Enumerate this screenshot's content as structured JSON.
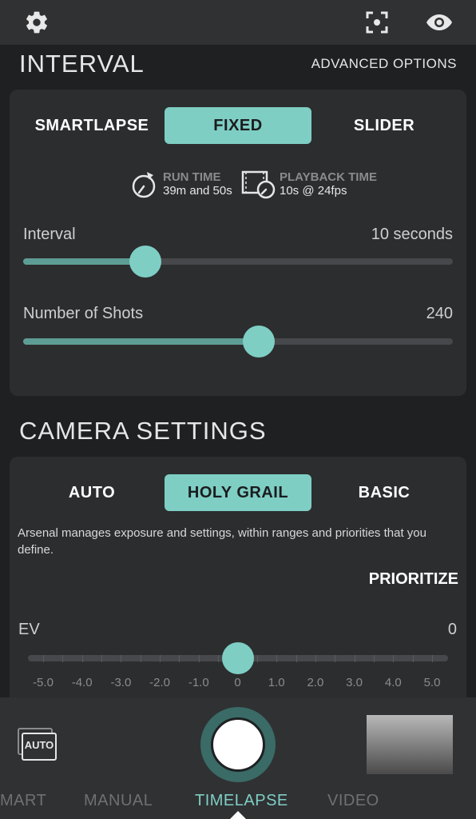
{
  "interval_section": {
    "title": "INTERVAL",
    "advanced_options": "ADVANCED OPTIONS",
    "tabs": [
      {
        "label": "SMARTLAPSE",
        "active": false
      },
      {
        "label": "FIXED",
        "active": true
      },
      {
        "label": "SLIDER",
        "active": false
      }
    ],
    "run_time": {
      "label": "RUN TIME",
      "value": "39m and 50s"
    },
    "playback_time": {
      "label": "PLAYBACK TIME",
      "value": "10s @ 24fps"
    },
    "interval": {
      "label": "Interval",
      "value": "10 seconds",
      "fraction": 0.285
    },
    "shots": {
      "label": "Number of Shots",
      "value": "240",
      "fraction": 0.548
    }
  },
  "camera_section": {
    "title": "CAMERA SETTINGS",
    "tabs": [
      {
        "label": "AUTO",
        "active": false
      },
      {
        "label": "HOLY GRAIL",
        "active": true
      },
      {
        "label": "BASIC",
        "active": false
      }
    ],
    "description": "Arsenal manages exposure and settings, within ranges and priorities that you define.",
    "prioritize": "PRIORITIZE",
    "ev": {
      "label": "EV",
      "value": "0",
      "min": -5.0,
      "max": 5.0,
      "current": 0.0
    },
    "ev_ticks": [
      "-5.0",
      "-4.0",
      "-3.0",
      "-2.0",
      "-1.0",
      "0",
      "1.0",
      "2.0",
      "3.0",
      "4.0",
      "5.0"
    ]
  },
  "bottom": {
    "auto_badge": "AUTO",
    "modes": [
      {
        "label": "MART",
        "active": false
      },
      {
        "label": "MANUAL",
        "active": false
      },
      {
        "label": "TIMELAPSE",
        "active": true
      },
      {
        "label": "VIDEO",
        "active": false
      }
    ]
  },
  "icons": {
    "settings": "gear-icon",
    "focus": "focus-frame-icon",
    "preview": "eye-icon",
    "run_time": "timer-icon",
    "playback": "film-clock-icon",
    "auto_mode": "auto-photos-icon"
  },
  "colors": {
    "accent": "#7ecec4",
    "track_fill": "#5e9d95",
    "card": "#2c2d2f",
    "background": "#1f2022"
  }
}
